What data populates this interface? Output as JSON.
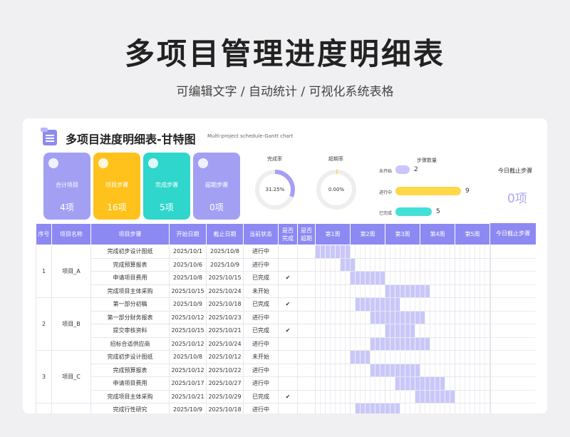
{
  "page": {
    "title": "多项目管理进度明细表",
    "subtitle": "可编辑文字 / 自动统计 / 可视化系统表格"
  },
  "sheet": {
    "title": "多项目进度明细表-甘特图",
    "subtitle": "Multi-project schedule-Gantt chart"
  },
  "stats": [
    {
      "label": "合计项目",
      "value": "4项",
      "color": "#a3a0f4",
      "icon": "list-icon"
    },
    {
      "label": "项目步骤",
      "value": "16项",
      "color": "#ffc21c",
      "icon": "minus-icon"
    },
    {
      "label": "完成步骤",
      "value": "5项",
      "color": "#2ed6cb",
      "icon": "check-icon"
    },
    {
      "label": "超期步骤",
      "value": "0项",
      "color": "#a3a0f4",
      "icon": "warning-icon"
    }
  ],
  "completion_ring": {
    "label": "完成率",
    "value": "31.25%",
    "fraction": 0.3125,
    "color": "#a3a0f4"
  },
  "overdue_ring": {
    "label": "超期率",
    "value": "0.00%",
    "fraction": 0.0,
    "color": "#ffd84a"
  },
  "step_counts": {
    "title": "步骤数量",
    "items": [
      {
        "label": "未开始",
        "count": "2",
        "value": 2,
        "color": "#c8c6fa"
      },
      {
        "label": "进行中",
        "count": "9",
        "value": 9,
        "color": "#ffd84a"
      },
      {
        "label": "已完成",
        "count": "5",
        "value": 5,
        "color": "#43e0d6"
      }
    ]
  },
  "today_stop": {
    "label": "今日截止步骤",
    "value": "0项"
  },
  "table": {
    "headers": [
      "序号",
      "项目名称",
      "项目步骤",
      "开始日期",
      "截止日期",
      "当前状态",
      "是否\n完成",
      "是否\n超期"
    ],
    "week_headers": [
      "第1周",
      "第2周",
      "第3周",
      "第4周",
      "第5周"
    ],
    "right_header": "今日截止步骤",
    "projects": [
      {
        "no": "1",
        "name": "项目_A"
      },
      {
        "no": "2",
        "name": "项目_B"
      },
      {
        "no": "3",
        "name": "项目_C"
      }
    ],
    "rows": [
      {
        "step": "完成初步设计图纸",
        "start": "2025/10/1",
        "end": "2025/10/8",
        "status": "进行中",
        "done": "",
        "overdue": "",
        "gantt_start": 0,
        "gantt_end": 7
      },
      {
        "step": "完成预算报表",
        "start": "2025/10/6",
        "end": "2025/10/9",
        "status": "进行中",
        "done": "",
        "overdue": "",
        "gantt_start": 5,
        "gantt_end": 8
      },
      {
        "step": "申请项目费用",
        "start": "2025/10/8",
        "end": "2025/10/15",
        "status": "已完成",
        "done": "✔",
        "overdue": "",
        "gantt_start": 7,
        "gantt_end": 14
      },
      {
        "step": "完成项目主体采购",
        "start": "2025/10/15",
        "end": "2025/10/24",
        "status": "未开始",
        "done": "",
        "overdue": "",
        "gantt_start": 14,
        "gantt_end": 23
      },
      {
        "step": "第一部分初稿",
        "start": "2025/10/9",
        "end": "2025/10/18",
        "status": "已完成",
        "done": "✔",
        "overdue": "",
        "gantt_start": 8,
        "gantt_end": 17
      },
      {
        "step": "第一部分财务报表",
        "start": "2025/10/12",
        "end": "2025/10/23",
        "status": "进行中",
        "done": "",
        "overdue": "",
        "gantt_start": 11,
        "gantt_end": 22
      },
      {
        "step": "提交审核资料",
        "start": "2025/10/15",
        "end": "2025/10/21",
        "status": "已完成",
        "done": "✔",
        "overdue": "",
        "gantt_start": 14,
        "gantt_end": 20
      },
      {
        "step": "招标合适供应商",
        "start": "2025/10/12",
        "end": "2025/10/24",
        "status": "进行中",
        "done": "",
        "overdue": "",
        "gantt_start": 11,
        "gantt_end": 23
      },
      {
        "step": "完成初步设计图纸",
        "start": "2025/10/8",
        "end": "2025/10/12",
        "status": "未开始",
        "done": "",
        "overdue": "",
        "gantt_start": 7,
        "gantt_end": 11
      },
      {
        "step": "完成预算报表",
        "start": "2025/10/12",
        "end": "2025/10/22",
        "status": "进行中",
        "done": "",
        "overdue": "",
        "gantt_start": 11,
        "gantt_end": 21
      },
      {
        "step": "申请项目费用",
        "start": "2025/10/17",
        "end": "2025/10/27",
        "status": "进行中",
        "done": "",
        "overdue": "",
        "gantt_start": 16,
        "gantt_end": 26
      },
      {
        "step": "完成项目主体采购",
        "start": "2025/10/21",
        "end": "2025/10/29",
        "status": "已完成",
        "done": "✔",
        "overdue": "",
        "gantt_start": 20,
        "gantt_end": 28
      },
      {
        "step": "完成行性研究",
        "start": "2025/10/9",
        "end": "2025/10/18",
        "status": "进行中",
        "done": "",
        "overdue": "",
        "gantt_start": 8,
        "gantt_end": 17
      }
    ],
    "gantt_color": "#c9c7fa",
    "gantt_days": 35
  }
}
